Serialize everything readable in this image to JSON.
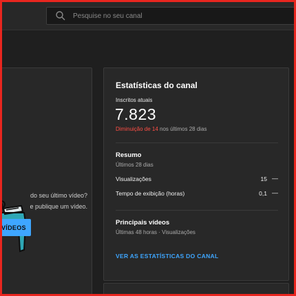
{
  "search": {
    "placeholder": "Pesquise no seu canal",
    "icon": "search-icon"
  },
  "left_card": {
    "promo_line1": "do seu último vídeo?",
    "promo_line2": "e publique um vídeo.",
    "button_label": "VÍDEOS"
  },
  "stats_card": {
    "title": "Estatísticas do canal",
    "subscribers_label": "Inscritos atuais",
    "subscribers_value": "7.823",
    "change_prefix": "Diminuição de 14",
    "change_suffix": " nos últimos 28 dias",
    "summary": {
      "title": "Resumo",
      "period": "Últimos 28 dias",
      "rows": [
        {
          "label": "Visualizações",
          "value": "15",
          "trend": "—"
        },
        {
          "label": "Tempo de exibição (horas)",
          "value": "0,1",
          "trend": "—"
        }
      ]
    },
    "top_videos": {
      "title": "Principais vídeos",
      "period": "Últimas 48 horas · Visualizações"
    },
    "link_label": "VER AS ESTATÍSTICAS DO CANAL"
  },
  "colors": {
    "accent": "#3ea6ff",
    "negative": "#ff4e45",
    "frame": "#e8261f",
    "background": "#1f1f1f",
    "card": "#282828"
  }
}
